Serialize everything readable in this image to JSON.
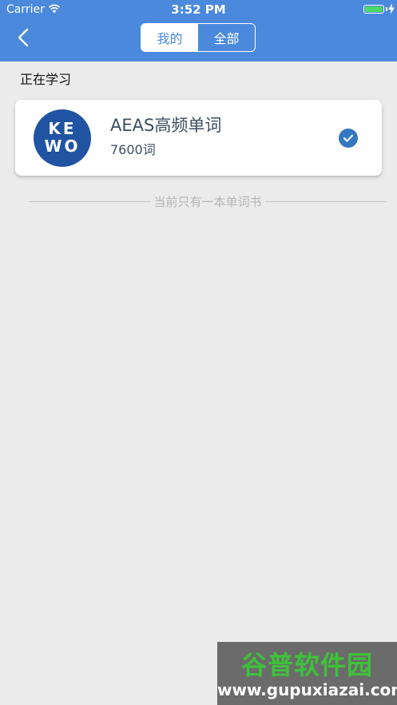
{
  "status_bar": {
    "carrier": "Carrier",
    "time": "3:52 PM",
    "icons": [
      "wifi-icon",
      "battery-icon",
      "charging-bolt-icon"
    ]
  },
  "nav": {
    "back_icon": "chevron-left-icon",
    "tabs": [
      {
        "label": "我的",
        "selected": true
      },
      {
        "label": "全部",
        "selected": false
      }
    ]
  },
  "section": {
    "title": "正在学习"
  },
  "book": {
    "logo_line1": "KE",
    "logo_line2": "WO",
    "name": "AEAS高频单词",
    "count": "7600词",
    "selected_icon": "checkmark-circle-icon"
  },
  "footer_note": "当前只有一本单词书",
  "watermark": {
    "title": "谷普软件园",
    "url": "www.gupuxiazai.com"
  },
  "colors": {
    "header": "#4a89dc",
    "background": "#ebebeb",
    "check": "#3478c0",
    "logo": "#2054a3",
    "battery": "#4cd964"
  }
}
